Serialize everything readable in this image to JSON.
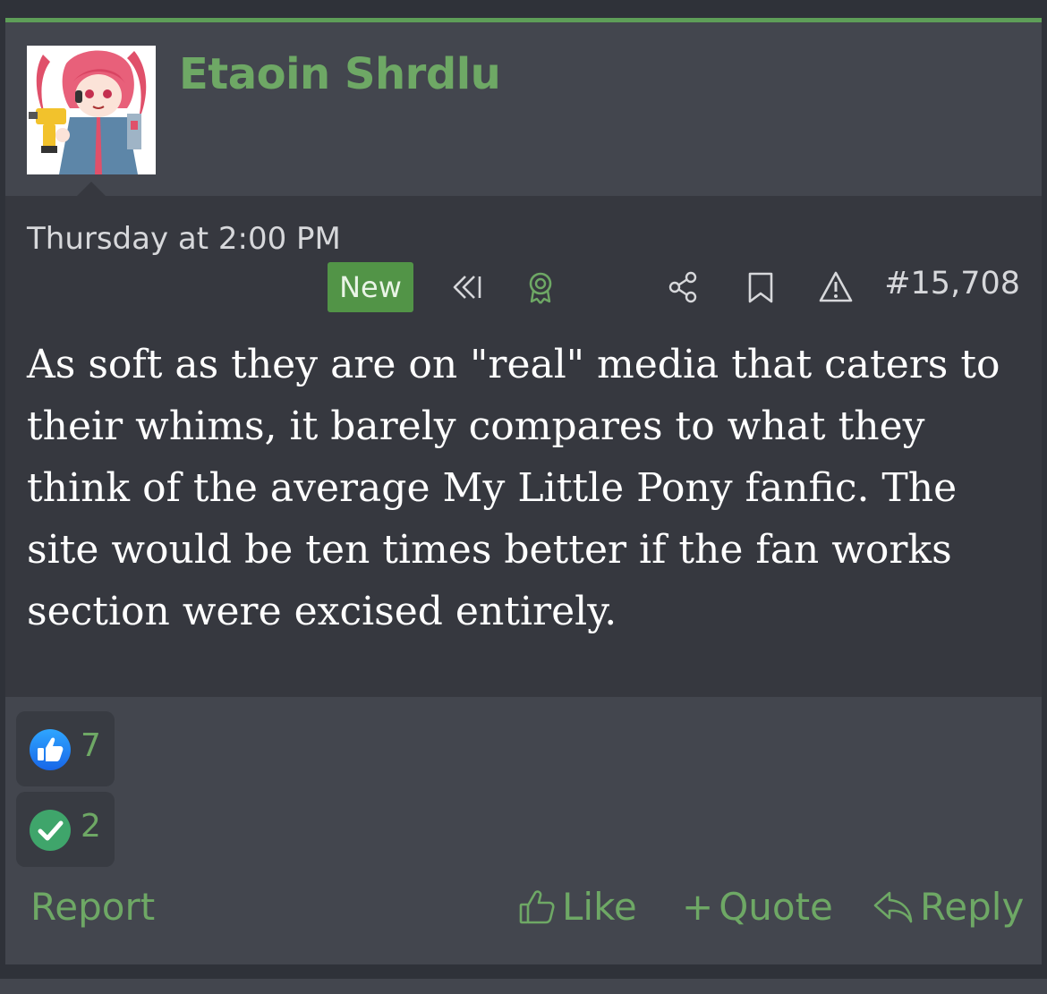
{
  "post": {
    "username": "Etaoin Shrdlu",
    "date": "Thursday at 2:00 PM",
    "new_badge": "New",
    "post_number": "#15,708",
    "message": "As soft as they are on \"real\" media that caters to their whims, it barely compares to what they think of the average My Little Pony fanfic. The site would be ten times better if the fan works section were excised entirely.",
    "toolbar_icons": [
      "rewind-icon",
      "award-icon",
      "share-icon",
      "bookmark-icon",
      "warning-icon"
    ]
  },
  "reactions": [
    {
      "icon": "thumbs-up-icon",
      "count": "7",
      "color": "#2d8cf0"
    },
    {
      "icon": "check-icon",
      "count": "2",
      "color": "#3fa56b"
    }
  ],
  "actions": {
    "report": "Report",
    "like": "Like",
    "quote": "Quote",
    "reply": "Reply"
  },
  "colors": {
    "accent": "#6ea865",
    "badge": "#529447",
    "post_bg": "#43464e",
    "body_bg": "#36383f"
  }
}
